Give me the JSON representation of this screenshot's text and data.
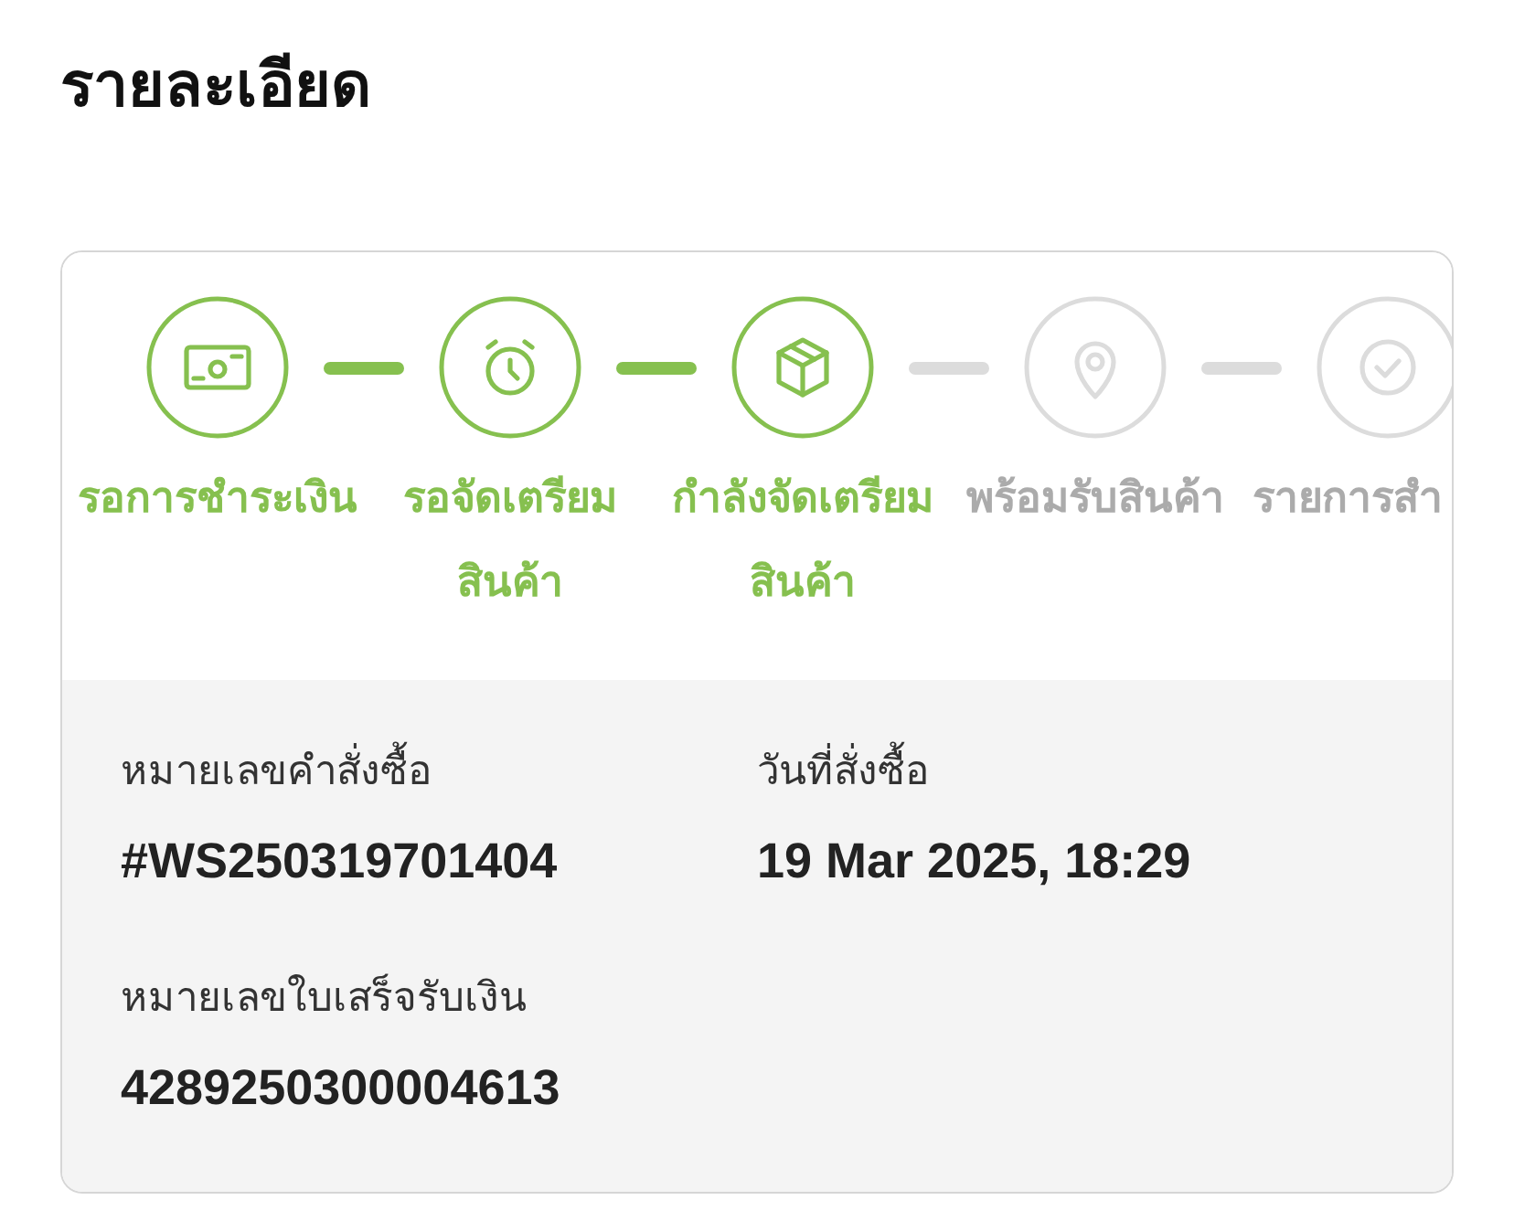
{
  "page": {
    "title": "รายละเอียด"
  },
  "steps": [
    {
      "label": "รอการชำระเงิน",
      "active": true
    },
    {
      "label": "รอจัดเตรียมสินค้า",
      "active": true
    },
    {
      "label": "กำลังจัดเตรียมสินค้า",
      "active": true
    },
    {
      "label": "พร้อมรับสินค้า",
      "active": false
    },
    {
      "label": "รายการสำ",
      "active": false
    }
  ],
  "details": [
    {
      "label": "หมายเลขคำสั่งซื้อ",
      "value": "#WS250319701404"
    },
    {
      "label": "วันที่สั่งซื้อ",
      "value": "19 Mar 2025, 18:29"
    },
    {
      "label": "หมายเลขใบเสร็จรับเงิน",
      "value": "4289250300004613"
    }
  ]
}
